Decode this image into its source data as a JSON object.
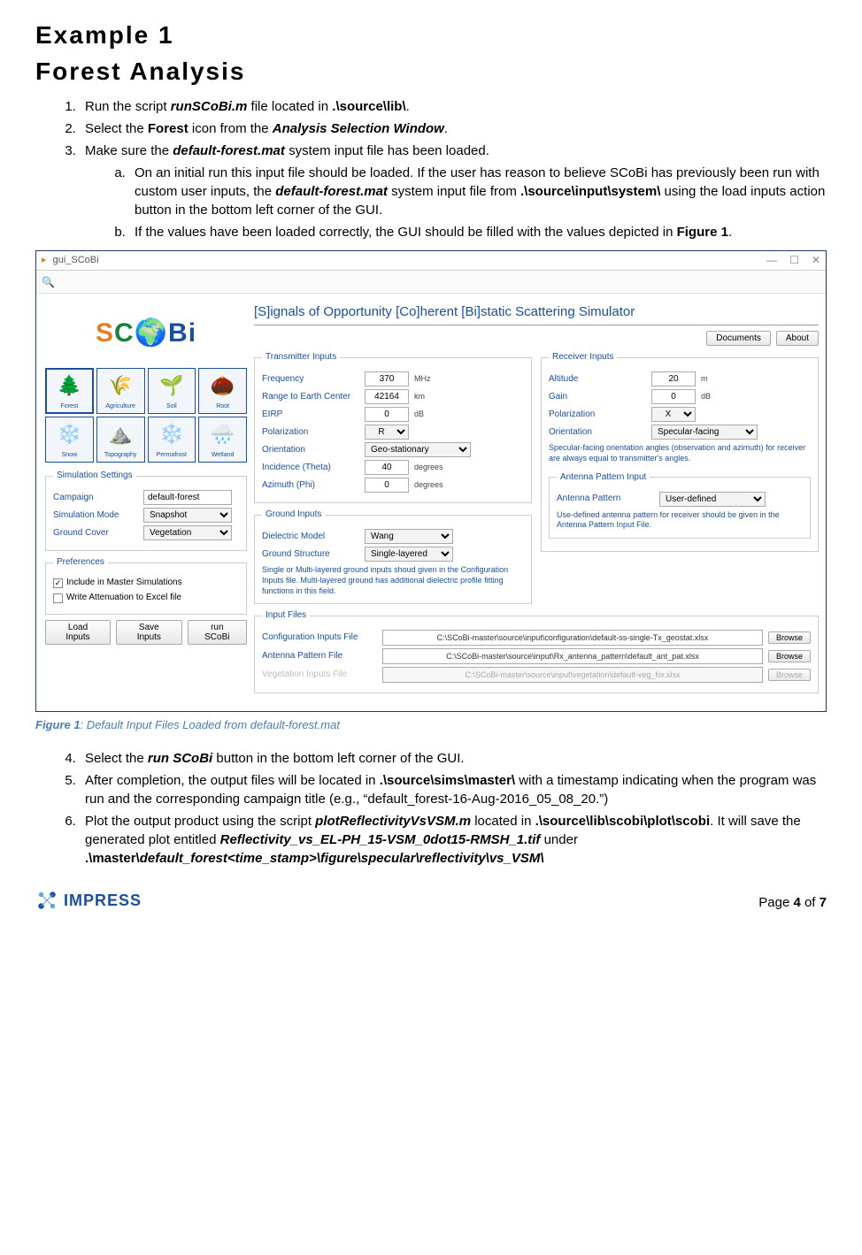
{
  "heading1": "Example 1",
  "heading2": "Forest Analysis",
  "steps": {
    "s1_a": "Run the script ",
    "s1_b": "runSCoBi.m",
    "s1_c": " file located in ",
    "s1_d": ".\\source\\lib\\",
    "s1_e": ".",
    "s2_a": "Select the ",
    "s2_b": "Forest",
    "s2_c": " icon from the ",
    "s2_d": "Analysis Selection Window",
    "s2_e": ".",
    "s3_a": "Make sure the ",
    "s3_b": "default-forest.mat",
    "s3_c": " system input file has been loaded.",
    "s3a_a": "On an initial run this input file should be loaded. If the user has reason to believe SCoBi has previously been run with custom user inputs, the ",
    "s3a_b": "default-forest.mat",
    "s3a_c": " system input file from ",
    "s3a_d": ".\\source\\input\\system\\",
    "s3a_e": " using the load inputs action button in the bottom left corner of the GUI.",
    "s3b_a": "If the values have been loaded correctly, the GUI should be filled with the values depicted in ",
    "s3b_b": "Figure 1",
    "s3b_c": ".",
    "s4_a": "Select the ",
    "s4_b": "run SCoBi",
    "s4_c": " button in the bottom left corner of the GUI.",
    "s5_a": "After completion, the output files will be located in ",
    "s5_b": ".\\source\\sims\\master\\",
    "s5_c": " with a timestamp indicating when the program was run and the corresponding campaign title (e.g., “default_forest-16-Aug-2016_05_08_20.”)",
    "s6_a": "Plot the output product using the script ",
    "s6_b": "plotReflectivityVsVSM.m",
    "s6_c": " located in ",
    "s6_d": ".\\source\\lib\\scobi\\plot\\scobi",
    "s6_e": ". It will save the generated plot entitled ",
    "s6_f": "Reflectivity_vs_EL-PH_15-VSM_0dot15-RMSH_1.tif",
    "s6_g": " under ",
    "s6_h": ".\\master\\",
    "s6_i": "default_forest<time_stamp>\\figure\\specular\\reflectivity\\vs_VSM\\"
  },
  "fig_caption_a": "Figure 1",
  "fig_caption_b": ": Default Input Files Loaded from default-forest.mat",
  "gui": {
    "win_title": "gui_SCoBi",
    "app_title": "[S]ignals of Opportunity [Co]herent [Bi]static Scattering Simulator",
    "btn_documents": "Documents",
    "btn_about": "About",
    "tiles": [
      "Forest",
      "Agriculture",
      "Soil",
      "Root",
      "Snow",
      "Topography",
      "Permafrost",
      "Wetland"
    ],
    "tile_icons": [
      "🌲",
      "🌾",
      "🌱",
      "🌰",
      "❄️",
      "⛰️",
      "❄️",
      "🌧️"
    ],
    "sim_legend": "Simulation Settings",
    "lbl_campaign": "Campaign",
    "val_campaign": "default-forest",
    "lbl_simmode": "Simulation Mode",
    "val_simmode": "Snapshot",
    "lbl_ground": "Ground Cover",
    "val_ground": "Vegetation",
    "pref_legend": "Preferences",
    "chk1": "Include in Master Simulations",
    "chk2": "Write Attenuation to Excel file",
    "btn_load": "Load Inputs",
    "btn_save": "Save Inputs",
    "btn_run": "run SCoBi",
    "tx_legend": "Transmitter Inputs",
    "tx_freq_l": "Frequency",
    "tx_freq_v": "370",
    "tx_freq_u": "MHz",
    "tx_range_l": "Range to Earth Center",
    "tx_range_v": "42164",
    "tx_range_u": "km",
    "tx_eirp_l": "EIRP",
    "tx_eirp_v": "0",
    "tx_eirp_u": "dB",
    "tx_pol_l": "Polarization",
    "tx_pol_v": "R",
    "tx_or_l": "Orientation",
    "tx_or_v": "Geo-stationary",
    "tx_inc_l": "Incidence (Theta)",
    "tx_inc_v": "40",
    "tx_inc_u": "degrees",
    "tx_az_l": "Azimuth (Phi)",
    "tx_az_v": "0",
    "tx_az_u": "degrees",
    "gnd_legend": "Ground Inputs",
    "gnd_diel_l": "Dielectric Model",
    "gnd_diel_v": "Wang",
    "gnd_struct_l": "Ground Structure",
    "gnd_struct_v": "Single-layered",
    "gnd_note": "Single or Multi-layered ground inputs shoud given in the Configuration Inputs file. Multi-layered ground has additional dielectric profile fitting functions in this field.",
    "rx_legend": "Receiver Inputs",
    "rx_alt_l": "Altitude",
    "rx_alt_v": "20",
    "rx_alt_u": "m",
    "rx_gain_l": "Gain",
    "rx_gain_v": "0",
    "rx_gain_u": "dB",
    "rx_pol_l": "Polarization",
    "rx_pol_v": "X",
    "rx_or_l": "Orientation",
    "rx_or_v": "Specular-facing",
    "rx_note": "Specular-facing orientation angles (observation and azimuth) for receiver are always equal to transmitter's angles.",
    "ant_legend": "Antenna Pattern Input",
    "ant_l": "Antenna Pattern",
    "ant_v": "User-defined",
    "ant_note": "Use-defined antenna pattern for receiver should be given in the Antenna Pattern Input File.",
    "if_legend": "Input Files",
    "if_conf_l": "Configuration Inputs File",
    "if_conf_v": "C:\\SCoBi-master\\source\\input\\configuration\\default-ss-single-Tx_geostat.xlsx",
    "if_ant_l": "Antenna Pattern File",
    "if_ant_v": "C:\\SCoBi-master\\source\\input\\Rx_antenna_pattern\\default_ant_pat.xlsx",
    "if_veg_l": "Vegetation Inputs File",
    "if_veg_v": "C:\\SCoBi-master\\source\\input\\vegetation\\default-veg_for.xlsx",
    "browse": "Browse"
  },
  "footer": {
    "logo": "IMPRESS",
    "page_a": "Page ",
    "page_b": "4",
    "page_c": " of ",
    "page_d": "7"
  }
}
